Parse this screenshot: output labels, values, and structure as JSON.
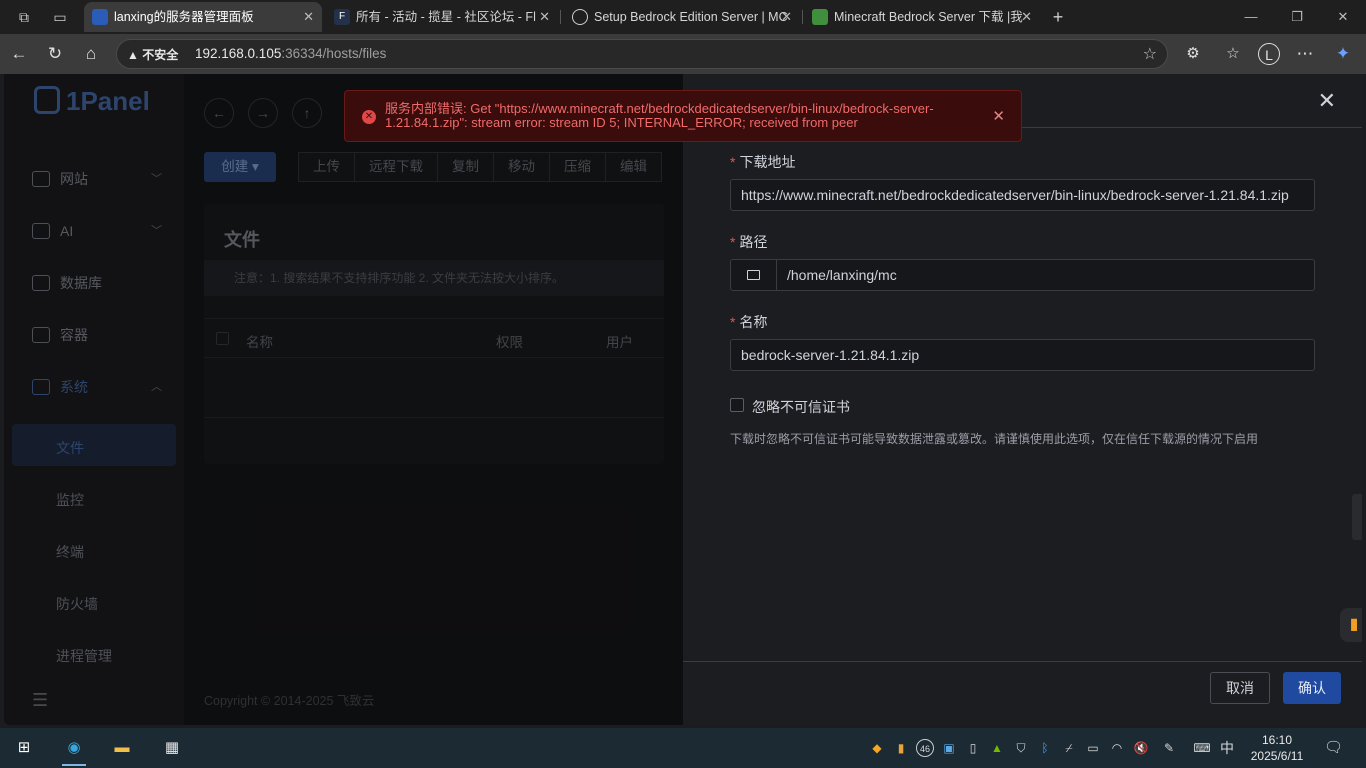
{
  "browser": {
    "tabs": [
      {
        "label": "lanxing的服务器管理面板",
        "active": true
      },
      {
        "label": "所有 - 活动 - 揽星 - 社区论坛 - Fl",
        "active": false
      },
      {
        "label": "Setup Bedrock Edition Server | MC",
        "active": false
      },
      {
        "label": "Minecraft Bedrock Server 下载 |我",
        "active": false
      }
    ],
    "security_label": "不安全",
    "url_host": "192.168.0.105",
    "url_rest": ":36334/hosts/files"
  },
  "app": {
    "logo": "1Panel",
    "sidebar": [
      {
        "label": "网站"
      },
      {
        "label": "AI"
      },
      {
        "label": "数据库"
      },
      {
        "label": "容器"
      },
      {
        "label": "系统"
      }
    ],
    "sidebar_sub": [
      "文件",
      "监控",
      "终端",
      "防火墙",
      "进程管理"
    ],
    "create_label": "创建",
    "toolbar": [
      "上传",
      "远程下载",
      "复制",
      "移动",
      "压缩",
      "编辑"
    ],
    "files_title": "文件",
    "files_note": "注意：1. 搜索结果不支持排序功能 2. 文件夹无法按大小排序。",
    "columns": {
      "name": "名称",
      "perm": "权限",
      "user": "用户"
    },
    "copyright": "Copyright © 2014-2025 飞致云"
  },
  "drawer": {
    "url_label": "下载地址",
    "url_value": "https://www.minecraft.net/bedrockdedicatedserver/bin-linux/bedrock-server-1.21.84.1.zip",
    "path_label": "路径",
    "path_value": "/home/lanxing/mc",
    "name_label": "名称",
    "name_value": "bedrock-server-1.21.84.1.zip",
    "ignore_cert_label": "忽略不可信证书",
    "hint": "下载时忽略不可信证书可能导致数据泄露或篡改。请谨慎使用此选项，仅在信任下载源的情况下启用",
    "cancel": "取消",
    "confirm": "确认"
  },
  "toast": {
    "message": "服务内部错误: Get \"https://www.minecraft.net/bedrockdedicatedserver/bin-linux/bedrock-server-1.21.84.1.zip\": stream error: stream ID 5; INTERNAL_ERROR; received from peer"
  },
  "taskbar": {
    "ime": "中",
    "time": "16:10",
    "date": "2025/6/11",
    "tray_badge": "46"
  },
  "colors": {
    "accent": "#1f4aa0",
    "error": "#f06b6b",
    "drawer_bg": "#1c1d21"
  }
}
